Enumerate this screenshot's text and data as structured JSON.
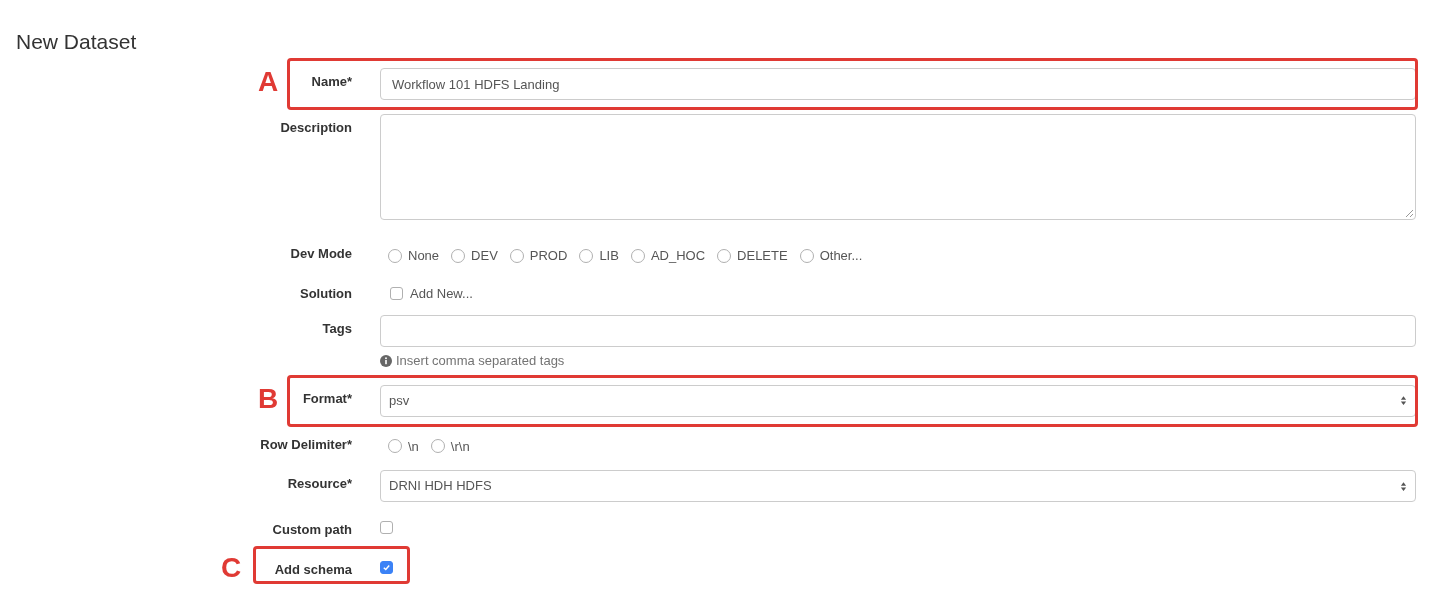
{
  "title": "New Dataset",
  "fields": [
    {
      "kind": "text",
      "label": "Name*",
      "value": "Workflow 101 HDFS Landing",
      "callout": "A"
    },
    {
      "kind": "textarea",
      "label": "Description"
    },
    {
      "kind": "radio",
      "label": "Dev Mode",
      "options": [
        {
          "label": "None",
          "selected": false
        },
        {
          "label": "DEV",
          "selected": false
        },
        {
          "label": "PROD",
          "selected": false
        },
        {
          "label": "LIB",
          "selected": false
        },
        {
          "label": "AD_HOC",
          "selected": false
        },
        {
          "label": "DELETE",
          "selected": false
        },
        {
          "label": "Other...",
          "selected": false
        }
      ]
    },
    {
      "kind": "checklist",
      "label": "Solution",
      "options": [
        {
          "label": "Add New...",
          "checked": false
        }
      ]
    },
    {
      "kind": "text",
      "label": "Tags",
      "help": "Insert comma separated tags"
    },
    {
      "kind": "select",
      "label": "Format*",
      "value": "psv",
      "callout": "B"
    },
    {
      "kind": "radio",
      "label": "Row Delimiter*",
      "options": [
        {
          "label": "\\n",
          "selected": false
        },
        {
          "label": "\\r\\n",
          "selected": false
        }
      ]
    },
    {
      "kind": "select",
      "label": "Resource*",
      "value": "DRNI HDH HDFS"
    },
    {
      "kind": "checkbox",
      "label": "Custom path",
      "checked": false
    },
    {
      "kind": "checkbox",
      "label": "Add schema",
      "checked": true,
      "callout": "C"
    }
  ]
}
